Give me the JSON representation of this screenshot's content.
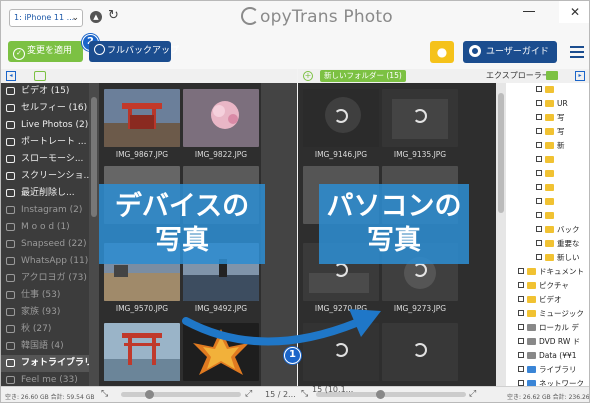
{
  "header": {
    "device": "1: iPhone 11 ...",
    "app_title": "opyTrans Photo",
    "close": "✕"
  },
  "toolbar": {
    "apply_label": "変更を適用",
    "backup_label": "フルバックアップ",
    "guide_label": "ユーザーガイド",
    "badge_1": "1",
    "badge_2": "2"
  },
  "left_panel": {
    "albums": [
      {
        "label": "ビデオ (15)",
        "icon": "video-icon",
        "dim": false
      },
      {
        "label": "セルフィー (16)",
        "icon": "person-icon",
        "dim": false
      },
      {
        "label": "Live Photos (2)",
        "icon": "live-icon",
        "dim": false
      },
      {
        "label": "ポートレート ...",
        "icon": "cube-icon",
        "dim": false
      },
      {
        "label": "スローモーシ...",
        "icon": "sun-icon",
        "dim": false
      },
      {
        "label": "スクリーンショ...",
        "icon": "screenshot-icon",
        "dim": false
      },
      {
        "label": "最近削除し...",
        "icon": "trash-icon",
        "dim": false
      },
      {
        "label": "Instagram (2)",
        "icon": "album-icon",
        "dim": true
      },
      {
        "label": "M o o d (1)",
        "icon": "album-icon",
        "dim": true
      },
      {
        "label": "Snapseed (22)",
        "icon": "album-icon",
        "dim": true
      },
      {
        "label": "WhatsApp (11)",
        "icon": "album-icon",
        "dim": true
      },
      {
        "label": "アクロヨガ (73)",
        "icon": "album-icon",
        "dim": true
      },
      {
        "label": "仕事 (53)",
        "icon": "album-icon",
        "dim": true
      },
      {
        "label": "家族 (93)",
        "icon": "album-icon",
        "dim": true
      },
      {
        "label": "秋 (27)",
        "icon": "album-icon",
        "dim": true
      },
      {
        "label": "韓国語 (4)",
        "icon": "album-icon",
        "dim": true
      },
      {
        "label": "フォトライブラリ ...",
        "icon": "camera-icon",
        "dim": false,
        "selected": true
      },
      {
        "label": "Feel me (33)",
        "icon": "album-icon",
        "dim": true
      }
    ],
    "photos": [
      {
        "name": "IMG_9867.JPG"
      },
      {
        "name": "IMG_9822.JPG"
      },
      {
        "name": "IMG_9570.JPG"
      },
      {
        "name": "IMG_9492.JPG"
      }
    ]
  },
  "right_panel": {
    "folder_tag": "新しいフォルダー (15)",
    "explorer_label": "エクスプローラー",
    "photos": [
      {
        "name": "IMG_9146.JPG"
      },
      {
        "name": "IMG_9135.JPG"
      },
      {
        "name": "IMG_9270.JPG"
      },
      {
        "name": "IMG_9273.JPG"
      }
    ],
    "tree": [
      {
        "label": "",
        "icon": "folder"
      },
      {
        "label": "UR",
        "icon": "folder"
      },
      {
        "label": "写",
        "icon": "folder"
      },
      {
        "label": "写",
        "icon": "folder"
      },
      {
        "label": "新",
        "icon": "folder"
      },
      {
        "label": "",
        "icon": "folder"
      },
      {
        "label": "",
        "icon": "folder"
      },
      {
        "label": "",
        "icon": "folder"
      },
      {
        "label": "",
        "icon": "folder"
      },
      {
        "label": "",
        "icon": "folder"
      },
      {
        "label": "バック",
        "icon": "folder"
      },
      {
        "label": "重要な",
        "icon": "folder"
      },
      {
        "label": "新しい",
        "icon": "folder"
      },
      {
        "label": "ドキュメント",
        "icon": "folder"
      },
      {
        "label": "ピクチャ",
        "icon": "folder"
      },
      {
        "label": "ビデオ",
        "icon": "folder"
      },
      {
        "label": "ミュージック",
        "icon": "folder"
      },
      {
        "label": "ローカル デ",
        "icon": "gray"
      },
      {
        "label": "DVD RW ド",
        "icon": "gray"
      },
      {
        "label": "Data (¥¥1",
        "icon": "gray"
      },
      {
        "label": "ライブラリ",
        "icon": "blue"
      },
      {
        "label": "ネットワーク",
        "icon": "blue"
      },
      {
        "label": "ごみ箱",
        "icon": "gray"
      },
      {
        "label": "11-backups-d",
        "icon": "folder"
      }
    ]
  },
  "overlays": {
    "device_label_1": "デバイスの",
    "device_label_2": "写真",
    "pc_label_1": "パソコンの",
    "pc_label_2": "写真"
  },
  "footer": {
    "left_status": "空き: 26.60 GB 合計: 59.54 GB",
    "page_counter": "15 / 2...",
    "right_count": "15 (10.1...",
    "right_status": "空き: 26.62 GB 合計: 236.26 GB"
  }
}
